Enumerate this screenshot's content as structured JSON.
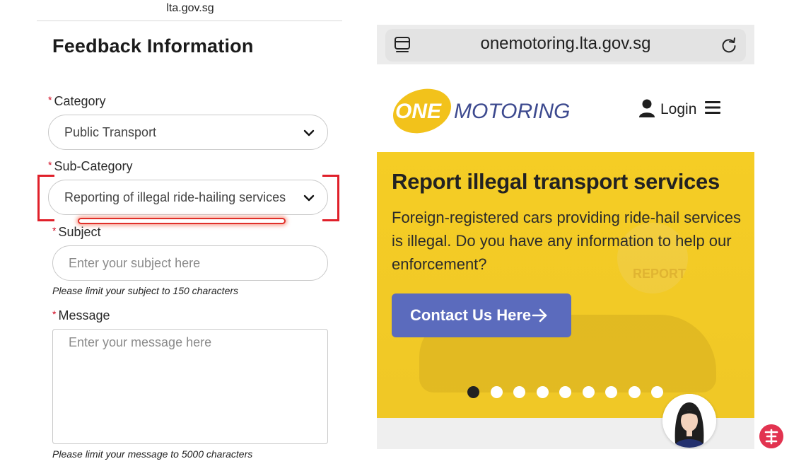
{
  "left": {
    "url": "lta.gov.sg",
    "title": "Feedback Information",
    "required_mark": "*",
    "category": {
      "label": "Category",
      "value": "Public Transport"
    },
    "sub_category": {
      "label": "Sub-Category",
      "value": "Reporting of illegal ride-hailing services"
    },
    "subject": {
      "label": "Subject",
      "placeholder": "Enter your subject here",
      "hint": "Please limit your subject to 150 characters"
    },
    "message": {
      "label": "Message",
      "placeholder": "Enter your message here",
      "hint": "Please limit your message to 5000 characters"
    }
  },
  "right": {
    "url": "onemotoring.lta.gov.sg",
    "logo": {
      "part1": "ONE",
      "part2": "MOTORING"
    },
    "login_label": "Login",
    "banner": {
      "title": "Report illegal transport services",
      "text": "Foreign-registered cars providing ride-hail services is illegal. Do you have any information to help our enforcement?",
      "background_text": "REPORT",
      "cta_label": "Contact Us Here",
      "slides_total": 9,
      "active_slide": 1
    }
  },
  "colors": {
    "banner_yellow": "#f5cd25",
    "cta_blue": "#5b6bbd",
    "logo_yellow": "#f2c21b",
    "logo_blue": "#3d4a8f",
    "highlight_red": "#e0202a",
    "required_red": "#d0021b"
  },
  "icons": [
    "tabs-icon",
    "reload-icon",
    "user-icon",
    "menu-icon",
    "chevron-down-icon",
    "arrow-right-icon",
    "avatar",
    "app-badge"
  ]
}
